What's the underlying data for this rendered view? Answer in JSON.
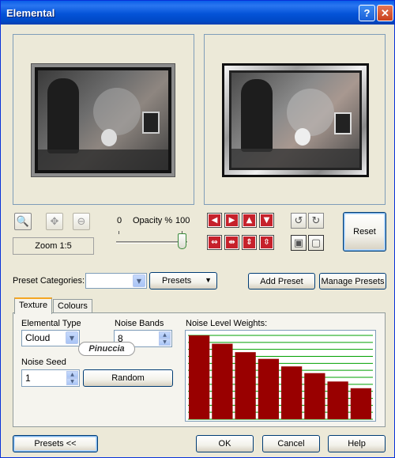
{
  "window": {
    "title": "Elemental",
    "help_glyph": "?",
    "close_glyph": "✕"
  },
  "preview": {
    "zoom_label": "Zoom 1:5"
  },
  "opacity": {
    "min_label": "0",
    "label": "Opacity %",
    "max_label": "100",
    "value": 100
  },
  "buttons": {
    "reset": "Reset",
    "add_preset": "Add Preset",
    "manage_presets": "Manage Presets",
    "presets_menu": "Presets",
    "presets_toggle": "Presets  <<",
    "ok": "OK",
    "cancel": "Cancel",
    "help": "Help"
  },
  "preset_categories": {
    "label": "Preset Categories:",
    "value": ""
  },
  "tabs": [
    {
      "label": "Texture",
      "active": true
    },
    {
      "label": "Colours",
      "active": false
    }
  ],
  "texture": {
    "elemental_type_label": "Elemental Type",
    "elemental_type_value": "Cloud",
    "noise_bands_label": "Noise Bands",
    "noise_bands_value": "8",
    "noise_seed_label": "Noise Seed",
    "noise_seed_value": "1",
    "random_label": "Random",
    "watermark": "Pinuccia"
  },
  "chart_data": {
    "type": "bar",
    "title": "Noise Level Weights:",
    "values": [
      1.0,
      0.9,
      0.8,
      0.72,
      0.63,
      0.55,
      0.45,
      0.37
    ],
    "ylim": [
      0,
      1
    ],
    "grid": true,
    "bar_color": "#990000",
    "grid_color": "#00a000"
  },
  "icons": {
    "zoom_in": "zoom-in-icon",
    "pan": "pan-icon",
    "zoom_out": "zoom-out-icon",
    "rotate_ccw": "rotate-ccw-icon",
    "rotate_cw": "rotate-cw-icon"
  },
  "colors": {
    "accent": "#0453d8",
    "arrow_button": "#c6212b"
  }
}
